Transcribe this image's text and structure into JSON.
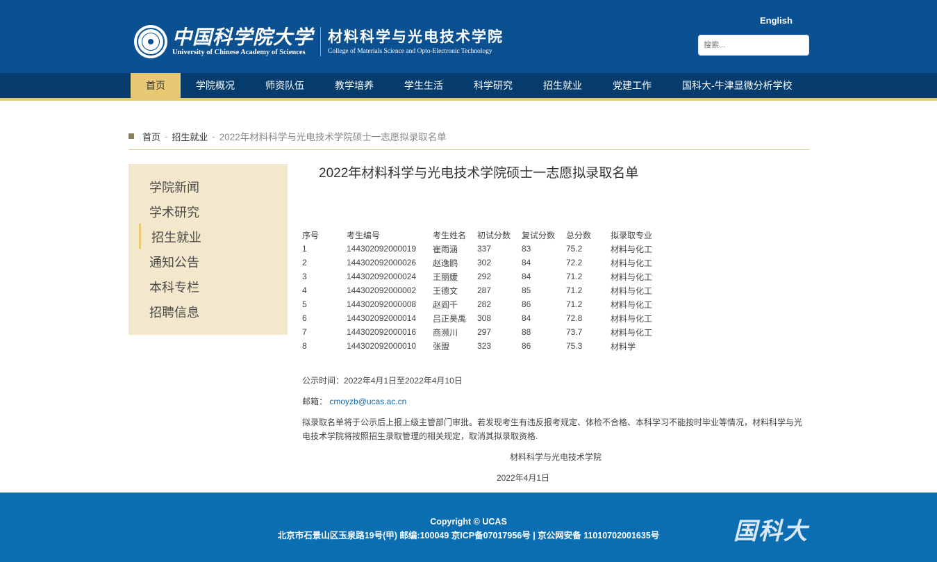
{
  "header": {
    "ucas_cn": "中国科学院大学",
    "ucas_en": "University of Chinese Academy of Sciences",
    "college_cn": "材料科学与光电技术学院",
    "college_en": "College of Materials Science and Opto-Electronic Technology",
    "english_link": "English",
    "search_placeholder": "搜索..."
  },
  "nav": {
    "items": [
      "首页",
      "学院概况",
      "师资队伍",
      "教学培养",
      "学生生活",
      "科学研究",
      "招生就业",
      "党建工作",
      "国科大-牛津显微分析学校"
    ],
    "active_index": 0
  },
  "breadcrumb": {
    "home": "首页",
    "section": "招生就业",
    "sep": "-",
    "current": "2022年材料科学与光电技术学院硕士一志愿拟录取名单"
  },
  "sidebar": {
    "items": [
      "学院新闻",
      "学术研究",
      "招生就业",
      "通知公告",
      "本科专栏",
      "招聘信息"
    ],
    "active_index": 2
  },
  "article": {
    "title": "2022年材料科学与光电技术学院硕士一志愿拟录取名单",
    "table": {
      "headers": [
        "序号",
        "考生编号",
        "考生姓名",
        "初试分数",
        "复试分数",
        "总分数",
        "拟录取专业"
      ],
      "rows": [
        [
          "1",
          "144302092000019",
          "崔雨涵",
          "337",
          "83",
          "75.2",
          "材料与化工"
        ],
        [
          "2",
          "144302092000026",
          "赵逸鸥",
          "302",
          "84",
          "72.2",
          "材料与化工"
        ],
        [
          "3",
          "144302092000024",
          "王丽媛",
          "292",
          "84",
          "71.2",
          "材料与化工"
        ],
        [
          "4",
          "144302092000002",
          "王德文",
          "287",
          "85",
          "71.2",
          "材料与化工"
        ],
        [
          "5",
          "144302092000008",
          "赵阎千",
          "282",
          "86",
          "71.2",
          "材料与化工"
        ],
        [
          "6",
          "144302092000014",
          "吕正昊禹",
          "308",
          "84",
          "72.8",
          "材料与化工"
        ],
        [
          "7",
          "144302092000016",
          "商濒川",
          "297",
          "88",
          "73.7",
          "材料与化工"
        ],
        [
          "8",
          "144302092000010",
          "张盟",
          "323",
          "86",
          "75.3",
          "材料学"
        ]
      ]
    },
    "publicity": "公示时间：2022年4月1日至2022年4月10日",
    "mail_label": "邮箱：",
    "mail": "cmoyzb@ucas.ac.cn",
    "note": "拟录取名单将于公示后上报上级主管部门审批。若发现考生有违反报考规定、体检不合格、本科学习不能按时毕业等情况，材料科学与光电技术学院将按照招生录取管理的相关规定，取消其拟录取资格.",
    "signature": "材料科学与光电技术学院",
    "date": "2022年4月1日"
  },
  "footer": {
    "copyright": "Copyright © UCAS",
    "address": "北京市石景山区玉泉路19号(甲) 邮编:100049 京ICP备07017956号 | 京公网安备 11010702001635号",
    "logo_text": "国科大"
  },
  "colors": {
    "header_blue": "#0b5192",
    "nav_dark": "#053c6c",
    "accent_gold": "#e7c873",
    "sidebar_bg": "#f3e8cb",
    "footer_blue": "#0b6db2",
    "link_blue": "#0b6fb7"
  },
  "icons": {
    "logo": "ucas-seal-icon",
    "breadcrumb_marker": "square-bullet-icon"
  }
}
